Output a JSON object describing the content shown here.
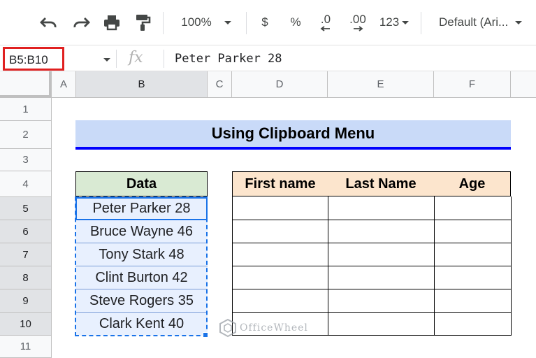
{
  "toolbar": {
    "zoom": "100%",
    "currency": "$",
    "percent": "%",
    "decrease_decimals": ".0",
    "increase_decimals": ".00",
    "number_format": "123",
    "font": "Default (Ari..."
  },
  "formula_bar": {
    "name_box": "B5:B10",
    "fx": "fx",
    "content": "Peter Parker 28"
  },
  "columns": [
    "A",
    "B",
    "C",
    "D",
    "E",
    "F"
  ],
  "rows": [
    "1",
    "2",
    "3",
    "4",
    "5",
    "6",
    "7",
    "8",
    "9",
    "10",
    "11"
  ],
  "sheet": {
    "title": "Using Clipboard Menu",
    "data_header": "Data",
    "data": [
      "Peter Parker 28",
      "Bruce Wayne 46",
      "Tony Stark 48",
      "Clint Burton 42",
      "Steve Rogers 35",
      "Clark Kent 40"
    ],
    "table_headers": [
      "First name",
      "Last Name",
      "Age"
    ]
  },
  "watermark": "OfficeWheel",
  "colors": {
    "title_fill": "#c9daf8",
    "title_underline": "#0000ff",
    "data_header_fill": "#d9ead3",
    "table_header_fill": "#fce5cd",
    "selection": "#1a73e8",
    "name_box_highlight": "#e02020"
  }
}
